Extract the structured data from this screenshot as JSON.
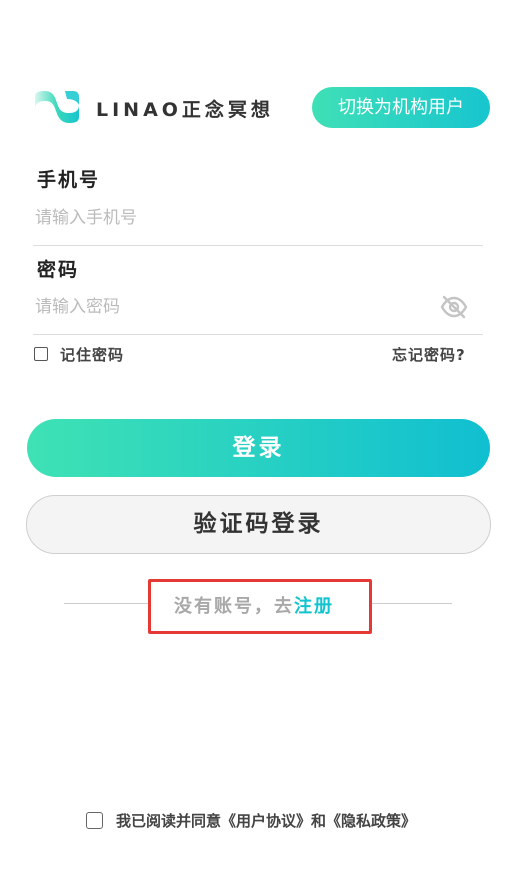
{
  "header": {
    "brand": "LINAO正念冥想",
    "switch_label": "切换为机构用户",
    "accent_start": "#3fe0b6",
    "accent_end": "#17c5cf"
  },
  "form": {
    "phone_label": "手机号",
    "phone_placeholder": "请输入手机号",
    "phone_value": "",
    "password_label": "密码",
    "password_placeholder": "请输入密码",
    "password_value": "",
    "password_toggle_icon": "eye-off-icon",
    "remember_label": "记住密码",
    "remember_checked": false,
    "forgot_label": "忘记密码?"
  },
  "actions": {
    "login_label": "登录",
    "code_login_label": "验证码登录"
  },
  "register": {
    "prompt": "没有账号，去",
    "link": "注册",
    "link_color": "#13c3cf"
  },
  "agreement": {
    "checked": false,
    "prefix": "我已阅读并同意",
    "user_agreement": "《用户协议》",
    "conjunction": "和",
    "privacy_policy": "《隐私政策》"
  }
}
